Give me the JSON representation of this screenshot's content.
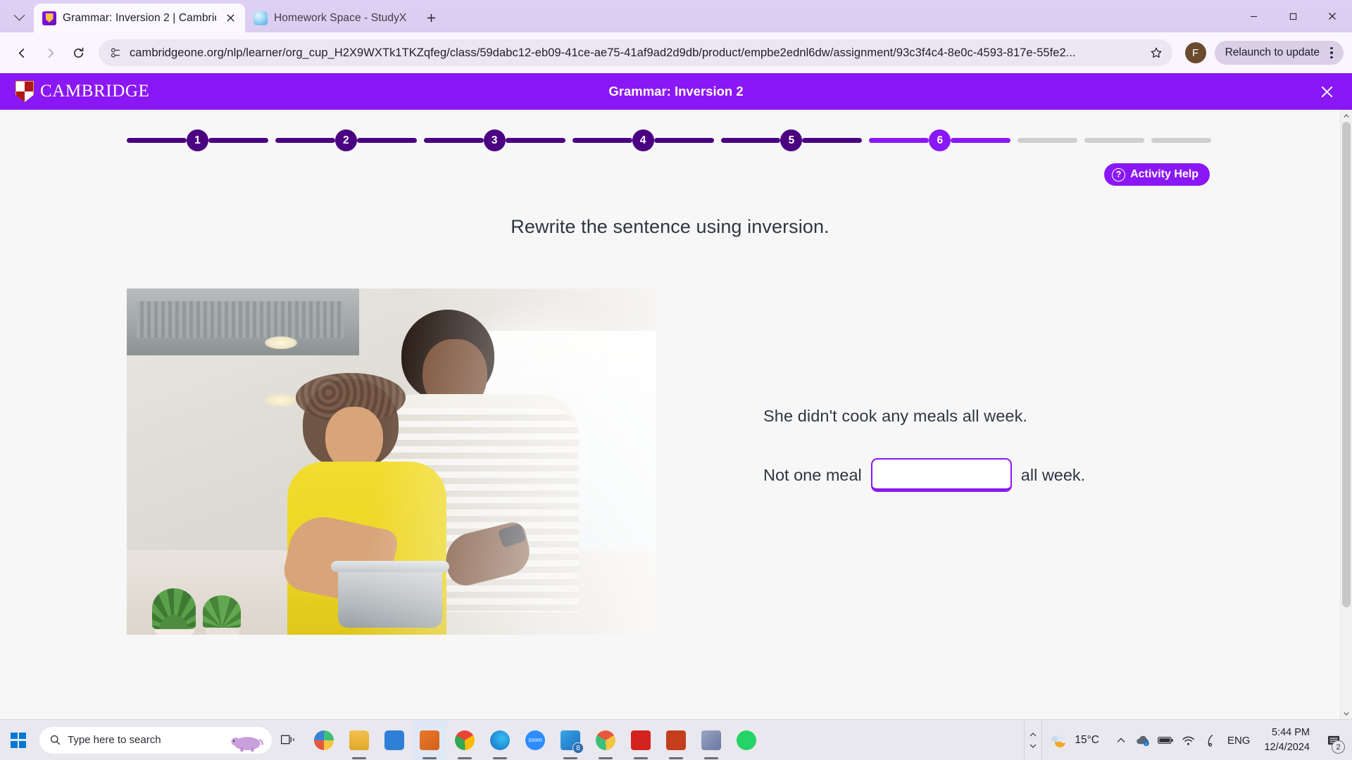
{
  "browser": {
    "tabs": [
      {
        "title": "Grammar: Inversion 2 | Cambrid",
        "favicon": "cambridge-shield-icon",
        "active": true
      },
      {
        "title": "Homework Space - StudyX",
        "favicon": "studyx-icon",
        "active": false
      }
    ],
    "new_tab_label": "+",
    "toolbar": {
      "back": "back-arrow-icon",
      "forward": "forward-arrow-icon",
      "reload": "reload-icon",
      "site_info": "site-settings-icon",
      "url": "cambridgeone.org/nlp/learner/org_cup_H2X9WXTk1TKZqfeg/class/59dabc12-eb09-41ce-ae75-41af9ad2d9db/product/empbe2ednl6dw/assignment/93c3f4c4-8e0c-4593-817e-55fe2...",
      "bookmark": "star-icon",
      "profile_initial": "F",
      "relaunch_label": "Relaunch to update",
      "menu": "kebab-menu-icon"
    },
    "window_controls": {
      "minimize": "minimize-icon",
      "maximize": "maximize-icon",
      "close": "close-icon"
    }
  },
  "cambridge": {
    "brand": "CAMBRIDGE",
    "title": "Grammar: Inversion 2",
    "close_label": "close-icon"
  },
  "activity": {
    "help_label": "Activity Help",
    "help_icon": "question-circle-icon",
    "instruction": "Rewrite the sentence using inversion.",
    "source_sentence": "She didn't cook any meals all week.",
    "answer_prefix": "Not one meal",
    "answer_suffix": "all week.",
    "answer_value": "",
    "answer_placeholder": "",
    "progress": {
      "total_steps": 9,
      "numbered_steps": [
        "1",
        "2",
        "3",
        "4",
        "5",
        "6"
      ],
      "current_step": "6",
      "completed_steps": [
        "1",
        "2",
        "3",
        "4",
        "5"
      ],
      "remaining_unnumbered": 3,
      "color_done": "#4B0082",
      "color_current": "#8A17F5",
      "color_todo": "#cfcfcf"
    },
    "image_alt": "couple cooking together in a kitchen"
  },
  "taskbar": {
    "start_label": "windows-start-icon",
    "search_placeholder": "Type here to search",
    "task_view": "task-view-icon",
    "apps": [
      {
        "name": "app-icon-1",
        "badge": ""
      },
      {
        "name": "file-explorer-icon",
        "badge": ""
      },
      {
        "name": "microsoft-store-icon",
        "badge": ""
      },
      {
        "name": "outlook-icon",
        "badge": ""
      },
      {
        "name": "chrome-icon",
        "badge": ""
      },
      {
        "name": "edge-icon",
        "badge": ""
      },
      {
        "name": "zoom-icon",
        "badge": ""
      },
      {
        "name": "mail-icon",
        "badge": "8"
      },
      {
        "name": "chrome-beta-icon",
        "badge": ""
      },
      {
        "name": "adobe-acrobat-icon",
        "badge": ""
      },
      {
        "name": "powerpoint-icon",
        "badge": ""
      },
      {
        "name": "teams-icon",
        "badge": ""
      },
      {
        "name": "whatsapp-icon",
        "badge": ""
      }
    ],
    "zoom_label": "zoom",
    "tray": {
      "show_hidden": "show-hidden-icons-icon",
      "weather_temp": "15°C",
      "weather_icon": "partly-cloudy-night-icon",
      "onedrive": "onedrive-icon",
      "battery": "battery-icon",
      "wifi": "wifi-icon",
      "pen": "pen-icon",
      "language": "ENG",
      "time": "5:44 PM",
      "date": "12/4/2024",
      "notification_count": "2"
    }
  }
}
